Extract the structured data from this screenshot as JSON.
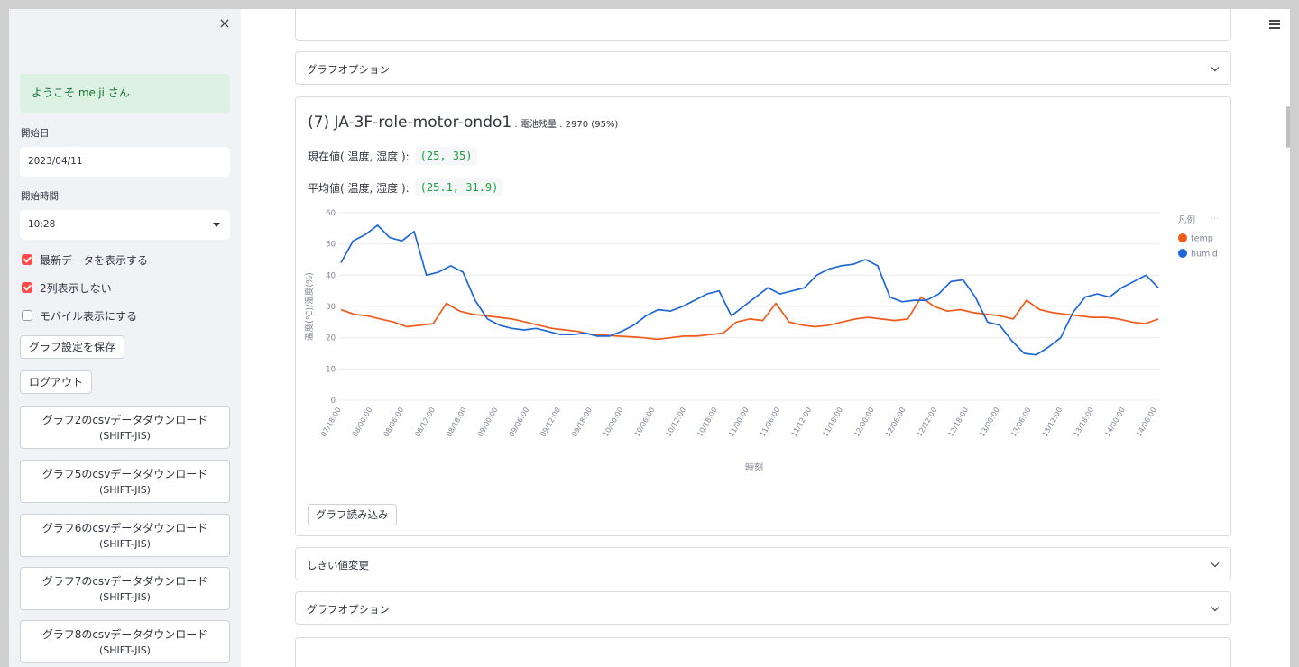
{
  "sidebar": {
    "close_icon": "×",
    "welcome": "ようこそ meiji さん",
    "start_date_label": "開始日",
    "start_date": "2023/04/11",
    "start_time_label": "開始時間",
    "start_time": "10:28",
    "checkboxes": [
      {
        "label": "最新データを表示する",
        "checked": true
      },
      {
        "label": "2列表示しない",
        "checked": true
      },
      {
        "label": "モバイル表示にする",
        "checked": false
      }
    ],
    "save_button": "グラフ設定を保存",
    "logout_button": "ログアウト",
    "downloads": [
      {
        "line1": "グラフ2のcsvデータダウンロード",
        "line2": "(SHIFT-JIS)"
      },
      {
        "line1": "グラフ5のcsvデータダウンロード",
        "line2": "(SHIFT-JIS)"
      },
      {
        "line1": "グラフ6のcsvデータダウンロード",
        "line2": "(SHIFT-JIS)"
      },
      {
        "line1": "グラフ7のcsvデータダウンロード",
        "line2": "(SHIFT-JIS)"
      },
      {
        "line1": "グラフ8のcsvデータダウンロード",
        "line2": "(SHIFT-JIS)"
      }
    ]
  },
  "main": {
    "graph_options_top": "グラフオプション",
    "graph_title": "(7) JA-3F-role-motor-ondo1",
    "battery": " : 電池残量 : 2970 (95%)",
    "current_label": "現在値( 温度, 湿度 ):",
    "current_value": "(25, 35)",
    "average_label": "平均値( 温度, 湿度 ):",
    "average_value": "(25.1, 31.9)",
    "load_button": "グラフ読み込み",
    "threshold": "しきい値変更",
    "graph_options_bottom": "グラフオプション"
  },
  "chart_data": {
    "type": "line",
    "ylabel": "温度(℃)/湿度(%)",
    "xlabel": "時刻",
    "ylim": [
      0,
      60
    ],
    "yticks": [
      0,
      10,
      20,
      30,
      40,
      50,
      60
    ],
    "xticks": [
      "07/18:00",
      "08/00:00",
      "08/06:00",
      "08/12:00",
      "08/18:00",
      "09/00:00",
      "09/06:00",
      "09/12:00",
      "09/18:00",
      "10/00:00",
      "10/06:00",
      "10/12:00",
      "10/18:00",
      "11/00:00",
      "11/06:00",
      "11/12:00",
      "11/18:00",
      "12/00:00",
      "12/06:00",
      "12/12:00",
      "12/18:00",
      "13/00:00",
      "13/06:00",
      "13/12:00",
      "13/18:00",
      "14/00:00",
      "14/06:00"
    ],
    "legend_title": "凡例",
    "legend_position": "right",
    "grid": true,
    "series": [
      {
        "name": "temp",
        "color": "#f05a1a",
        "values": [
          29,
          27.5,
          27,
          26,
          25,
          23.5,
          24,
          24.5,
          31,
          28.5,
          27.5,
          27,
          26.5,
          26,
          25,
          24,
          23,
          22.5,
          22,
          21,
          20.8,
          20.5,
          20.3,
          20,
          19.5,
          20,
          20.5,
          20.5,
          21,
          21.5,
          25,
          26,
          25.5,
          31,
          25,
          24,
          23.5,
          24,
          25,
          26,
          26.5,
          26,
          25.5,
          26,
          33,
          30,
          28.5,
          29,
          28,
          27.5,
          27,
          26,
          32,
          29,
          28,
          27.5,
          27,
          26.5,
          26.5,
          26,
          25,
          24.5,
          26
        ]
      },
      {
        "name": "humid",
        "color": "#1f67d6",
        "values": [
          44,
          51,
          53,
          56,
          52,
          51,
          54,
          40,
          41,
          43,
          41,
          32,
          26,
          24,
          23,
          22.5,
          23,
          22,
          21,
          21,
          21.5,
          20.5,
          20.5,
          22,
          24,
          27,
          29,
          28.5,
          30,
          32,
          34,
          35,
          27,
          30,
          33,
          36,
          34,
          35,
          36,
          40,
          42,
          43,
          43.5,
          45,
          43,
          33,
          31.5,
          32,
          32,
          34,
          38,
          38.5,
          33,
          25,
          24,
          19,
          15,
          14.5,
          17,
          20,
          28,
          33,
          34,
          33,
          36,
          38,
          40,
          36
        ]
      }
    ]
  }
}
